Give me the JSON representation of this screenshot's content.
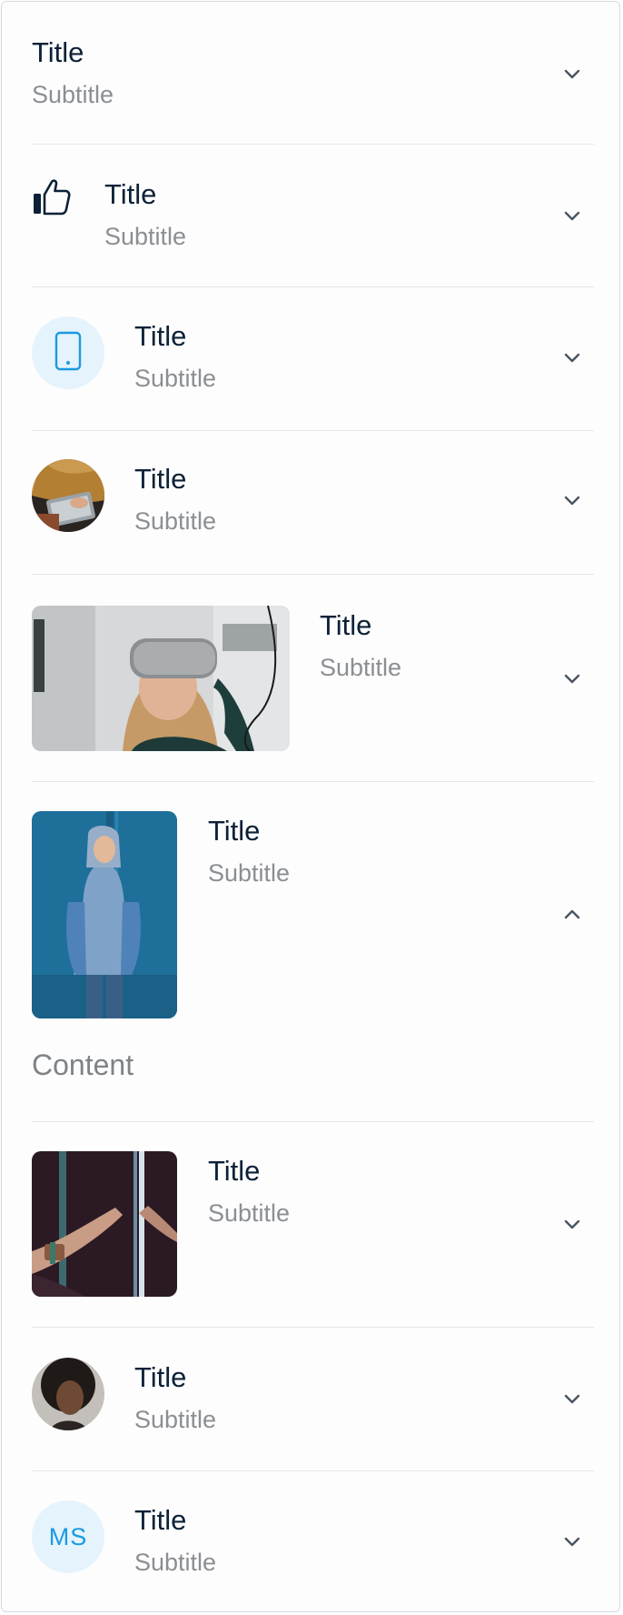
{
  "items": [
    {
      "title": "Title",
      "subtitle": "Subtitle",
      "media": "none",
      "expanded": false
    },
    {
      "title": "Title",
      "subtitle": "Subtitle",
      "media": "thumbs-up-icon",
      "expanded": false
    },
    {
      "title": "Title",
      "subtitle": "Subtitle",
      "media": "phone-icon",
      "expanded": false
    },
    {
      "title": "Title",
      "subtitle": "Subtitle",
      "media": "avatar-photo-laptop",
      "expanded": false
    },
    {
      "title": "Title",
      "subtitle": "Subtitle",
      "media": "wide-photo-vr-headset",
      "expanded": false
    },
    {
      "title": "Title",
      "subtitle": "Subtitle",
      "media": "tall-photo-person-hoodie",
      "expanded": true,
      "content": "Content"
    },
    {
      "title": "Title",
      "subtitle": "Subtitle",
      "media": "square-photo-hands",
      "expanded": false
    },
    {
      "title": "Title",
      "subtitle": "Subtitle",
      "media": "avatar-photo-person",
      "expanded": false
    },
    {
      "title": "Title",
      "subtitle": "Subtitle",
      "media": "initials-avatar",
      "initials": "MS",
      "expanded": false
    }
  ],
  "colors": {
    "title": "#0c2137",
    "subtitle": "#8b8f93",
    "accent": "#1a9ae0",
    "accent_bg": "#e4f3fc",
    "divider": "#e3e6e8",
    "chevron": "#4a5560"
  }
}
